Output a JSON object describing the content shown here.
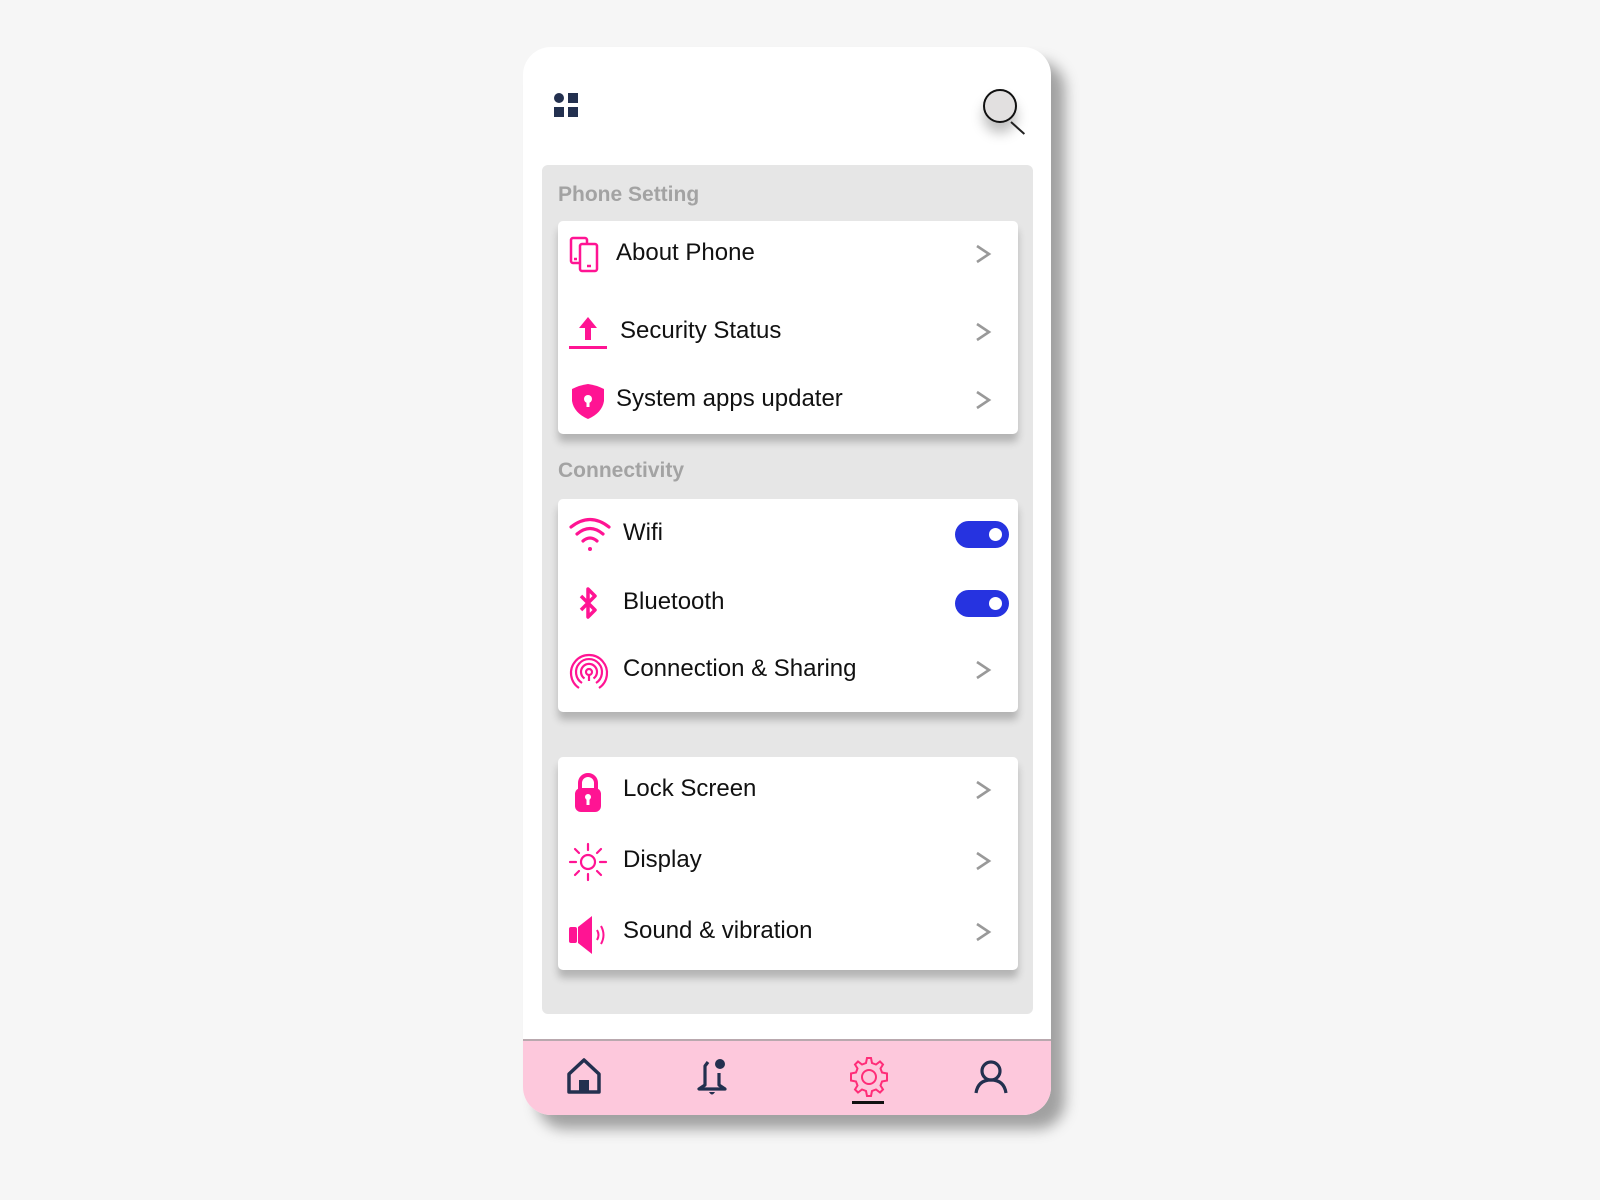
{
  "header": {
    "menu_icon": "apps-grid-icon",
    "search_icon": "search-icon"
  },
  "sections": [
    {
      "title": "Phone Setting",
      "items": [
        {
          "label": "About Phone",
          "icon": "devices-icon",
          "control": "chevron"
        },
        {
          "label": "Security Status",
          "icon": "upload-icon",
          "control": "chevron"
        },
        {
          "label": "System apps updater",
          "icon": "shield-lock-icon",
          "control": "chevron"
        }
      ]
    },
    {
      "title": "Connectivity",
      "items": [
        {
          "label": "Wifi",
          "icon": "wifi-icon",
          "control": "toggle",
          "on": true
        },
        {
          "label": "Bluetooth",
          "icon": "bluetooth-icon",
          "control": "toggle",
          "on": true
        },
        {
          "label": "Connection & Sharing",
          "icon": "broadcast-icon",
          "control": "chevron"
        }
      ]
    },
    {
      "title": "",
      "items": [
        {
          "label": "Lock Screen",
          "icon": "lock-icon",
          "control": "chevron"
        },
        {
          "label": "Display",
          "icon": "brightness-icon",
          "control": "chevron"
        },
        {
          "label": "Sound & vibration",
          "icon": "speaker-icon",
          "control": "chevron"
        }
      ]
    }
  ],
  "bottom_nav": {
    "items": [
      {
        "name": "home",
        "icon": "home-icon"
      },
      {
        "name": "notifications",
        "icon": "bell-icon"
      },
      {
        "name": "settings",
        "icon": "gear-icon",
        "active": true
      },
      {
        "name": "profile",
        "icon": "user-icon"
      }
    ]
  },
  "colors": {
    "accent": "#ff1493",
    "toggle_on": "#2633e0",
    "nav_background": "#fdc8dc",
    "nav_icon": "#23304f",
    "section_title": "#a3a3a3"
  }
}
